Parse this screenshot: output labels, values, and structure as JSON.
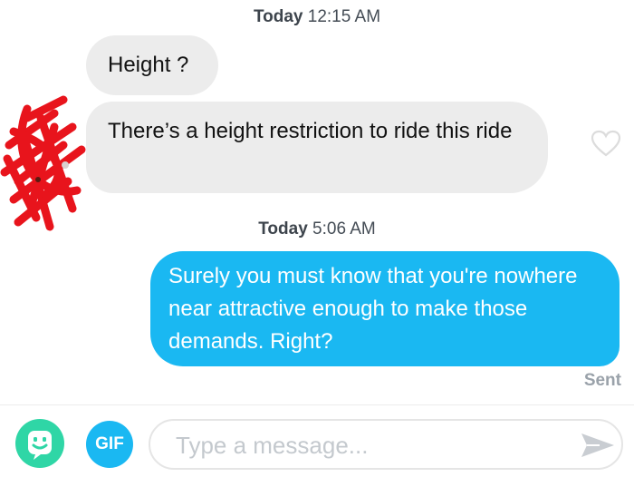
{
  "conversation": {
    "groups": [
      {
        "day": "Today",
        "time": "12:15 AM"
      },
      {
        "day": "Today",
        "time": "5:06 AM"
      }
    ],
    "messages": [
      {
        "direction": "received",
        "text": "Height ?"
      },
      {
        "direction": "received",
        "text": "There’s a height restriction to ride this ride"
      },
      {
        "direction": "sent",
        "text": "Surely you must know that you're nowhere near attractive enough to make those demands. Right?"
      }
    ],
    "sent_status": "Sent"
  },
  "composer": {
    "gif_label": "GIF",
    "placeholder": "Type a message..."
  },
  "icons": {
    "sticker": "sticker-face-icon",
    "heart": "heart-outline-icon",
    "send": "send-arrow-icon"
  },
  "colors": {
    "sent_bubble": "#1ab8f2",
    "received_bubble": "#ececec",
    "sticker_button": "#2fd6a6",
    "gif_button": "#1ab8f2",
    "redaction": "#e8141c"
  }
}
